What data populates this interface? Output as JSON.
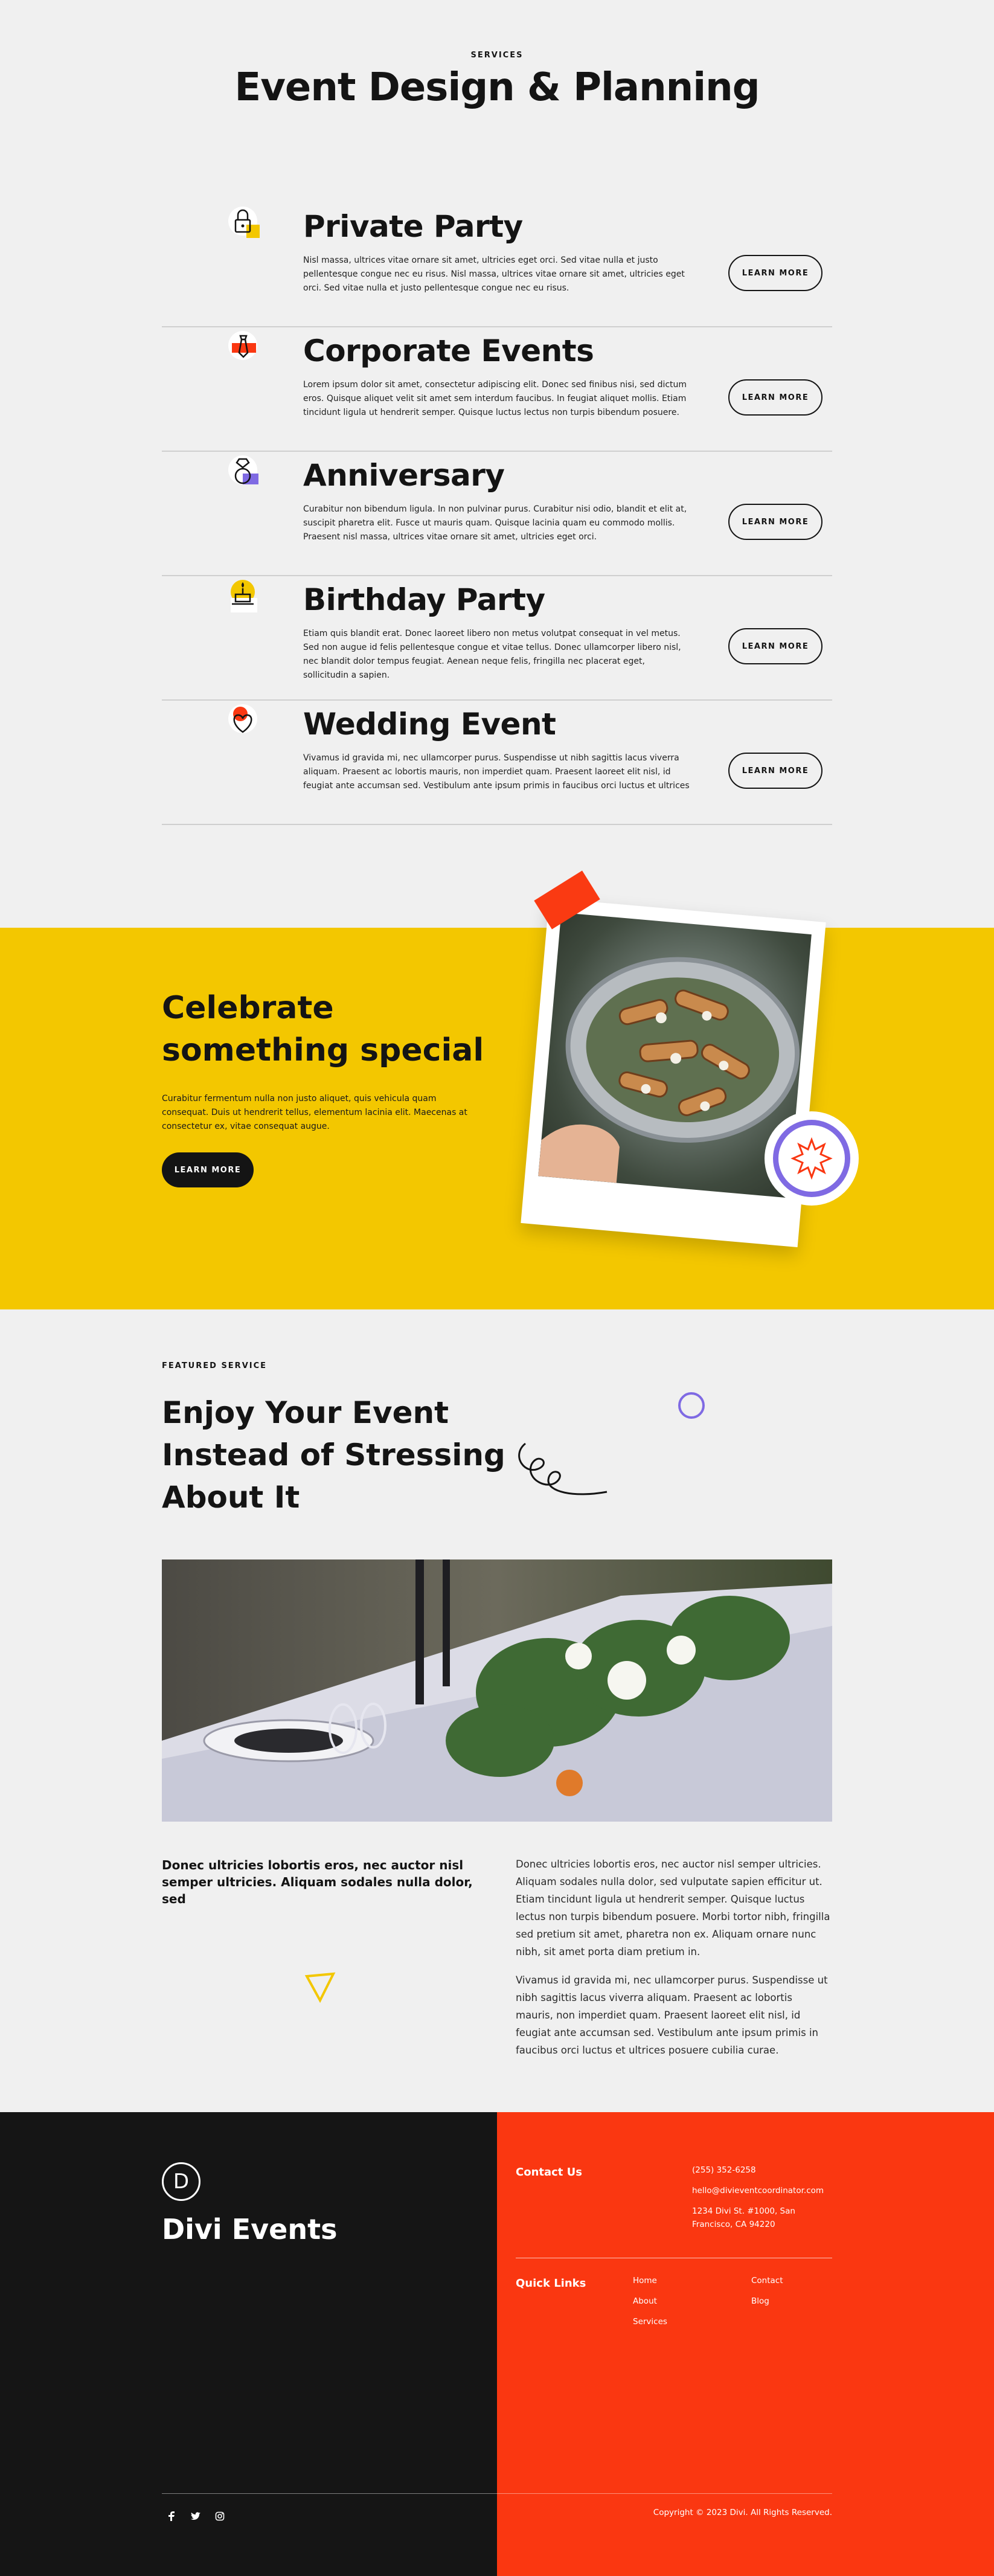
{
  "services": {
    "eyebrow": "SERVICES",
    "title": "Event Design & Planning",
    "button_label": "LEARN MORE",
    "items": [
      {
        "title": "Private Party",
        "icon": "lock-icon",
        "description": "Nisl massa, ultrices vitae ornare sit amet, ultricies eget orci. Sed vitae nulla et justo pellentesque congue nec eu risus. Nisl massa, ultrices vitae ornare sit amet, ultricies eget orci. Sed vitae nulla et justo pellentesque congue nec eu risus."
      },
      {
        "title": "Corporate Events",
        "icon": "necktie-icon",
        "description": "Lorem ipsum dolor sit amet, consectetur adipiscing elit. Donec sed finibus nisi, sed dictum eros. Quisque aliquet velit sit amet sem interdum faucibus. In feugiat aliquet mollis. Etiam tincidunt ligula ut hendrerit semper. Quisque luctus lectus non turpis bibendum posuere."
      },
      {
        "title": "Anniversary",
        "icon": "ring-icon",
        "description": "Curabitur non bibendum ligula. In non pulvinar purus. Curabitur nisi odio, blandit et elit at, suscipit pharetra elit. Fusce ut mauris quam. Quisque lacinia quam eu commodo mollis. Praesent nisl massa, ultrices vitae ornare sit amet, ultricies eget orci."
      },
      {
        "title": "Birthday Party",
        "icon": "cake-icon",
        "description": "Etiam quis blandit erat. Donec laoreet libero non metus volutpat consequat in vel metus. Sed non augue id felis pellentesque congue et vitae tellus. Donec ullamcorper libero nisl, nec blandit dolor tempus feugiat. Aenean neque felis, fringilla nec placerat eget, sollicitudin a sapien."
      },
      {
        "title": "Wedding Event",
        "icon": "heart-icon",
        "description": "Vivamus id gravida mi, nec ullamcorper purus. Suspendisse ut nibh sagittis lacus viverra aliquam. Praesent ac lobortis mauris, non imperdiet quam. Praesent laoreet elit nisl, id feugiat ante accumsan sed. Vestibulum ante ipsum primis in faucibus orci luctus et ultrices"
      }
    ]
  },
  "celebrate": {
    "title": "Celebrate something special",
    "description": "Curabitur fermentum nulla non justo aliquet, quis vehicula quam consequat. Duis ut hendrerit tellus, elementum lacinia elit. Maecenas at consectetur ex, vitae consequat augue.",
    "button_label": "LEARN MORE"
  },
  "featured": {
    "eyebrow": "FEATURED SERVICE",
    "title": "Enjoy Your Event Instead of Stressing About It",
    "lead": "Donec ultricies lobortis eros, nec auctor nisl semper ultricies. Aliquam sodales nulla dolor, sed",
    "paragraph1": "Donec ultricies lobortis eros, nec auctor nisl semper ultricies. Aliquam sodales nulla dolor, sed vulputate sapien efficitur ut. Etiam tincidunt ligula ut hendrerit semper. Quisque luctus lectus non turpis bibendum posuere. Morbi tortor nibh, fringilla sed pretium sit amet, pharetra non ex. Aliquam ornare nunc nibh, sit amet porta diam pretium in.",
    "paragraph2": "Vivamus id gravida mi, nec ullamcorper purus. Suspendisse ut nibh sagittis lacus viverra aliquam. Praesent ac lobortis mauris, non imperdiet quam. Praesent laoreet elit nisl, id feugiat ante accumsan sed. Vestibulum ante ipsum primis in faucibus orci luctus et ultrices posuere cubilia curae."
  },
  "footer": {
    "logo_letter": "D",
    "brand": "Divi Events",
    "contact_heading": "Contact Us",
    "phone": "(255) 352-6258",
    "email": "hello@divieventcoordinator.com",
    "address": "1234 Divi St. #1000, San Francisco, CA 94220",
    "quick_heading": "Quick Links",
    "links_col1": [
      "Home",
      "About",
      "Services"
    ],
    "links_col2": [
      "Contact",
      "Blog"
    ],
    "social": [
      "facebook-icon",
      "twitter-icon",
      "instagram-icon"
    ],
    "copyright": "Copyright © 2023 Divi. All Rights Reserved."
  },
  "colors": {
    "accent_yellow": "#f3c700",
    "accent_red": "#fa3711",
    "accent_purple": "#7f6ae3",
    "dark": "#151515"
  }
}
